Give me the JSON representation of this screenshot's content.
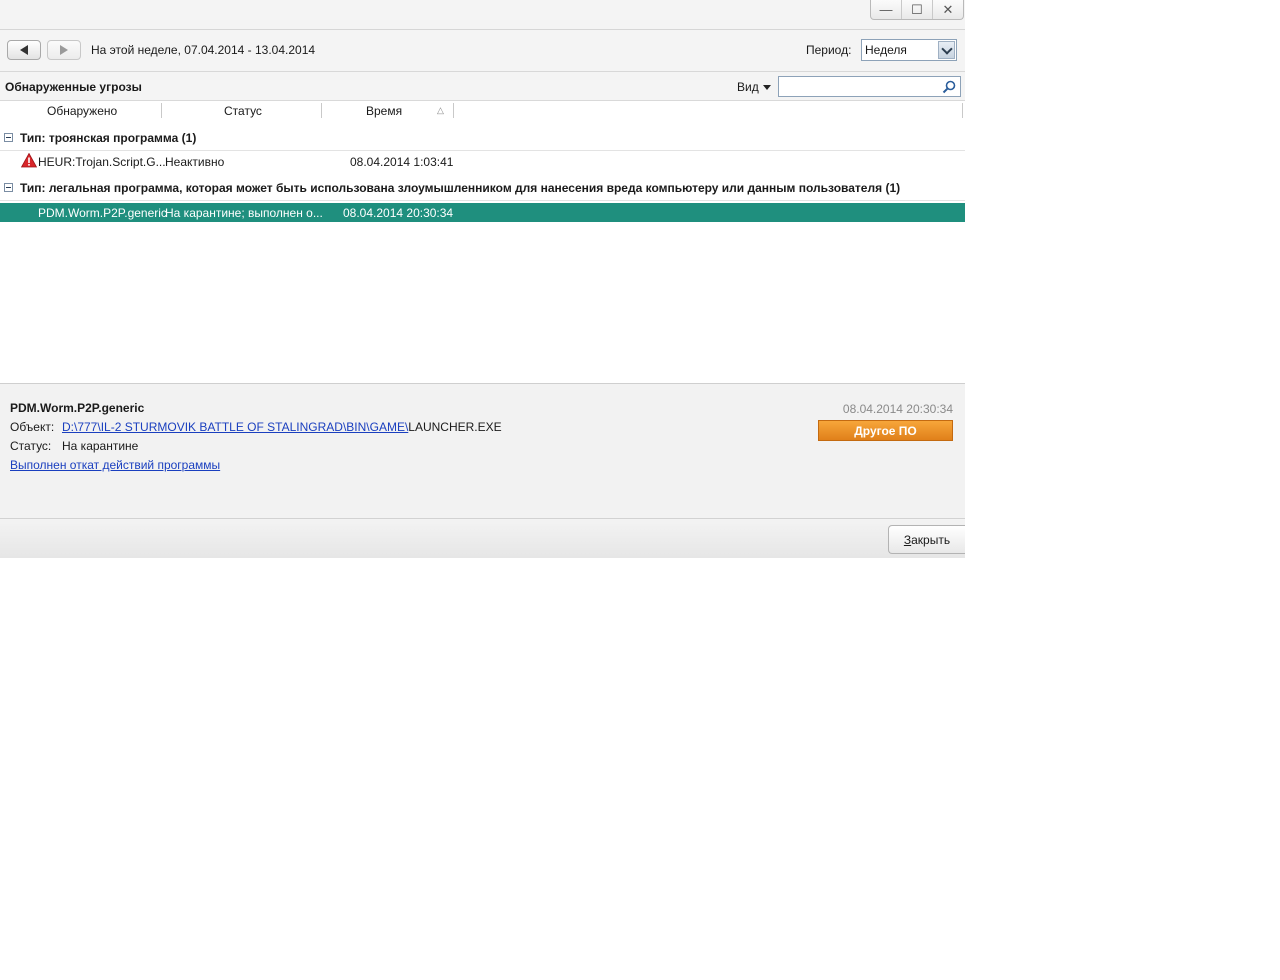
{
  "window_controls": {
    "minimize": "—",
    "maximize": "☐",
    "close": "✕"
  },
  "nav": {
    "period_text": "На этой неделе, 07.04.2014 - 13.04.2014",
    "period_label": "Период:",
    "period_value": "Неделя"
  },
  "section": {
    "title": "Обнаруженные угрозы",
    "view_label": "Вид",
    "search_value": ""
  },
  "columns": [
    "Обнаружено",
    "Статус",
    "Время"
  ],
  "groups": [
    {
      "title": "Тип: троянская программа (1)",
      "items": [
        {
          "name": "HEUR:Trojan.Script.G...",
          "status": "Неактивно",
          "time": "08.04.2014 1:03:41",
          "icon": "warning-icon",
          "selected": false
        }
      ]
    },
    {
      "title": "Тип: легальная программа, которая может быть использована злоумышленником для нанесения вреда компьютеру или данным пользователя (1)",
      "items": [
        {
          "name": "PDM.Worm.P2P.generic",
          "status": "На карантине; выполнен о...",
          "time": "08.04.2014 20:30:34",
          "icon": "",
          "selected": true
        }
      ]
    }
  ],
  "details": {
    "name": "PDM.Worm.P2P.generic",
    "object_label": "Объект:",
    "object_path_link": "D:\\777\\IL-2 STURMOVIK BATTLE OF STALINGRAD\\BIN\\GAME\\",
    "object_file": "LAUNCHER.EXE",
    "status_label": "Статус:",
    "status_value": "На карантине",
    "rollback_link": "Выполнен откат действий программы",
    "time": "08.04.2014 20:30:34",
    "category_button": "Другое ПО"
  },
  "footer": {
    "close_button_first": "З",
    "close_button_rest": "акрыть"
  },
  "colors": {
    "selected_row": "#1f8f7e",
    "category_button": "#f09a2d",
    "link": "#1a3fbf"
  }
}
